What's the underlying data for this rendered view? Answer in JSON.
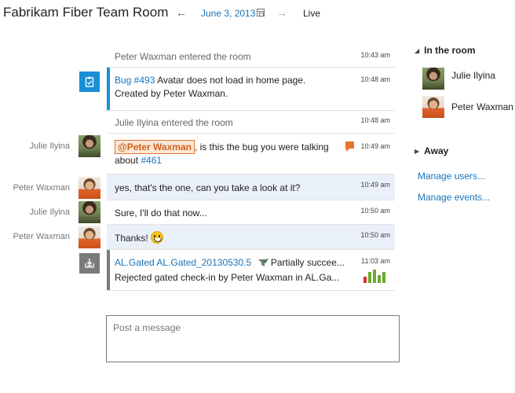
{
  "header": {
    "title": "Fabrikam Fiber Team Room",
    "date": "June 3, 2013",
    "live": "Live"
  },
  "messages": [
    {
      "sender": "",
      "text": "Peter Waxman entered the room",
      "time": "10:43 am"
    },
    {
      "sender": "",
      "link": "Bug #493",
      "text": " Avatar does not load in home page.",
      "line2": "Created by Peter Waxman.",
      "time": "10:48 am"
    },
    {
      "sender": "",
      "text": "Julie Ilyina entered the room",
      "time": "10:48 am"
    },
    {
      "sender": "Julie Ilyina",
      "mention": "@Peter Waxman",
      "text": ", is this the bug you were talking",
      "line2_prefix": "about ",
      "line2_link": "#461",
      "time": "10:49 am"
    },
    {
      "sender": "Peter Waxman",
      "text": "yes, that's the one, can you take a look at it?",
      "time": "10:49 am"
    },
    {
      "sender": "Julie Ilyina",
      "text": "Sure, I'll do that now...",
      "time": "10:50 am"
    },
    {
      "sender": "Peter Waxman",
      "text": "Thanks!",
      "time": "10:50 am"
    },
    {
      "sender": "",
      "link": "AL.Gated AL.Gated_20130530.5",
      "status": "Partially succee...",
      "line2": "Rejected gated check-in by Peter Waxman in AL.Ga...",
      "time": "11:03 am",
      "build_bars": [
        0.45,
        0.75,
        0.95,
        0.55,
        0.8
      ]
    }
  ],
  "composer": {
    "placeholder": "Post a message"
  },
  "sidebar": {
    "in_room_label": "In the room",
    "members": [
      "Julie Ilyina",
      "Peter Waxman"
    ],
    "away_label": "Away",
    "manage_users": "Manage users...",
    "manage_events": "Manage events..."
  },
  "colors": {
    "accent_blue": "#1a8fd6",
    "accent_gray": "#7a7a7a",
    "mention_orange": "#e8742c",
    "highlight_row": "#eaf0f9",
    "bar_red": "#d9342b",
    "bar_green": "#6aab2e"
  }
}
